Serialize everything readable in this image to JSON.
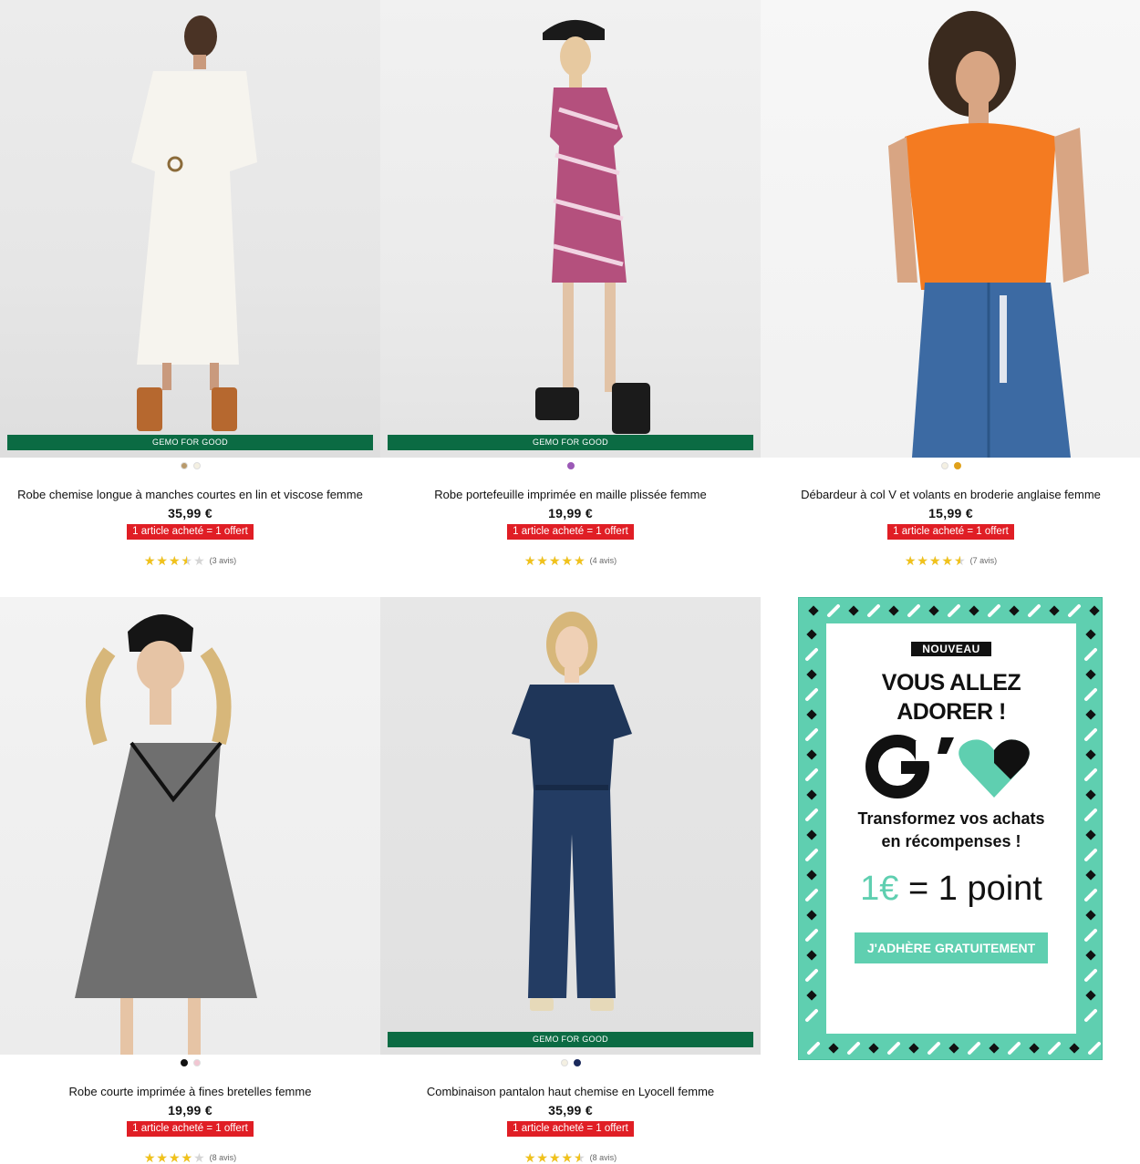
{
  "colors": {
    "accent_green": "#0b6b43",
    "promo_red": "#e01e25",
    "star_yellow": "#f1c21b",
    "mint": "#5fcfb0"
  },
  "products": [
    {
      "title": "Robe chemise longue à manches courtes en lin et viscose femme",
      "price": "35,99 €",
      "promo": "1 article acheté = 1 offert",
      "badge": "GEMO FOR GOOD",
      "rating": 3.5,
      "reviews": "(3 avis)",
      "swatches": [
        "#b8996a",
        "#f4f0e2"
      ]
    },
    {
      "title": "Robe portefeuille imprimée en maille plissée femme",
      "price": "19,99 €",
      "promo": "1 article acheté = 1 offert",
      "badge": "GEMO FOR GOOD",
      "rating": 5,
      "reviews": "(4 avis)",
      "swatches": [
        "#9b59b6"
      ]
    },
    {
      "title": "Débardeur à col V et volants en broderie anglaise femme",
      "price": "15,99 €",
      "promo": "1 article acheté = 1 offert",
      "badge": "",
      "rating": 4.5,
      "reviews": "(7 avis)",
      "swatches": [
        "#f4f0e2",
        "#e0a11b"
      ]
    },
    {
      "title": "Robe courte imprimée à fines bretelles femme",
      "price": "19,99 €",
      "promo": "1 article acheté = 1 offert",
      "badge": "",
      "rating": 4,
      "reviews": "(8 avis)",
      "swatches": [
        "#111111",
        "#f2c6d2"
      ]
    },
    {
      "title": "Combinaison pantalon haut chemise en Lyocell femme",
      "price": "35,99 €",
      "promo": "1 article acheté = 1 offert",
      "badge": "GEMO FOR GOOD",
      "rating": 4.5,
      "reviews": "(8 avis)",
      "swatches": [
        "#f4f0e2",
        "#1b2a5c"
      ]
    }
  ],
  "banner": {
    "new_label": "NOUVEAU",
    "headline_1": "VOUS ALLEZ",
    "headline_2": "ADORER !",
    "logo_letter": "G",
    "sub_1": "Transformez vos achats",
    "sub_2": "en récompenses !",
    "points_euro": "1€",
    "points_rest": "= 1 point",
    "cta": "J'ADHÈRE GRATUITEMENT"
  }
}
